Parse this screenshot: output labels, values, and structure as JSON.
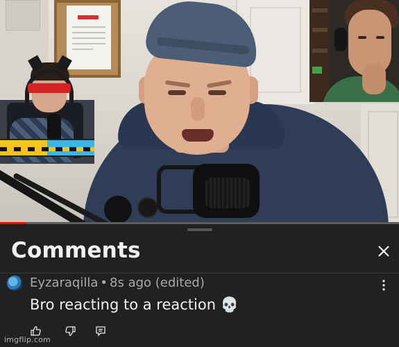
{
  "video": {
    "progress_fraction": 0.065
  },
  "comments_panel": {
    "title": "Comments",
    "close_icon": "close-icon"
  },
  "comment": {
    "author": "Eyzaraqilla",
    "separator": "•",
    "time": "8s ago (edited)",
    "text": "Bro reacting to a reaction 💀",
    "icons": {
      "avatar": "avatar",
      "more": "more-vert-icon",
      "like": "thumb-up-icon",
      "dislike": "thumb-down-icon",
      "reply": "reply-icon"
    }
  },
  "watermark": "imgflip.com",
  "colors": {
    "sheet_bg": "#212121",
    "progress": "#ff0000",
    "text_primary": "#f1f1f1",
    "text_secondary": "#aaaaaa"
  }
}
